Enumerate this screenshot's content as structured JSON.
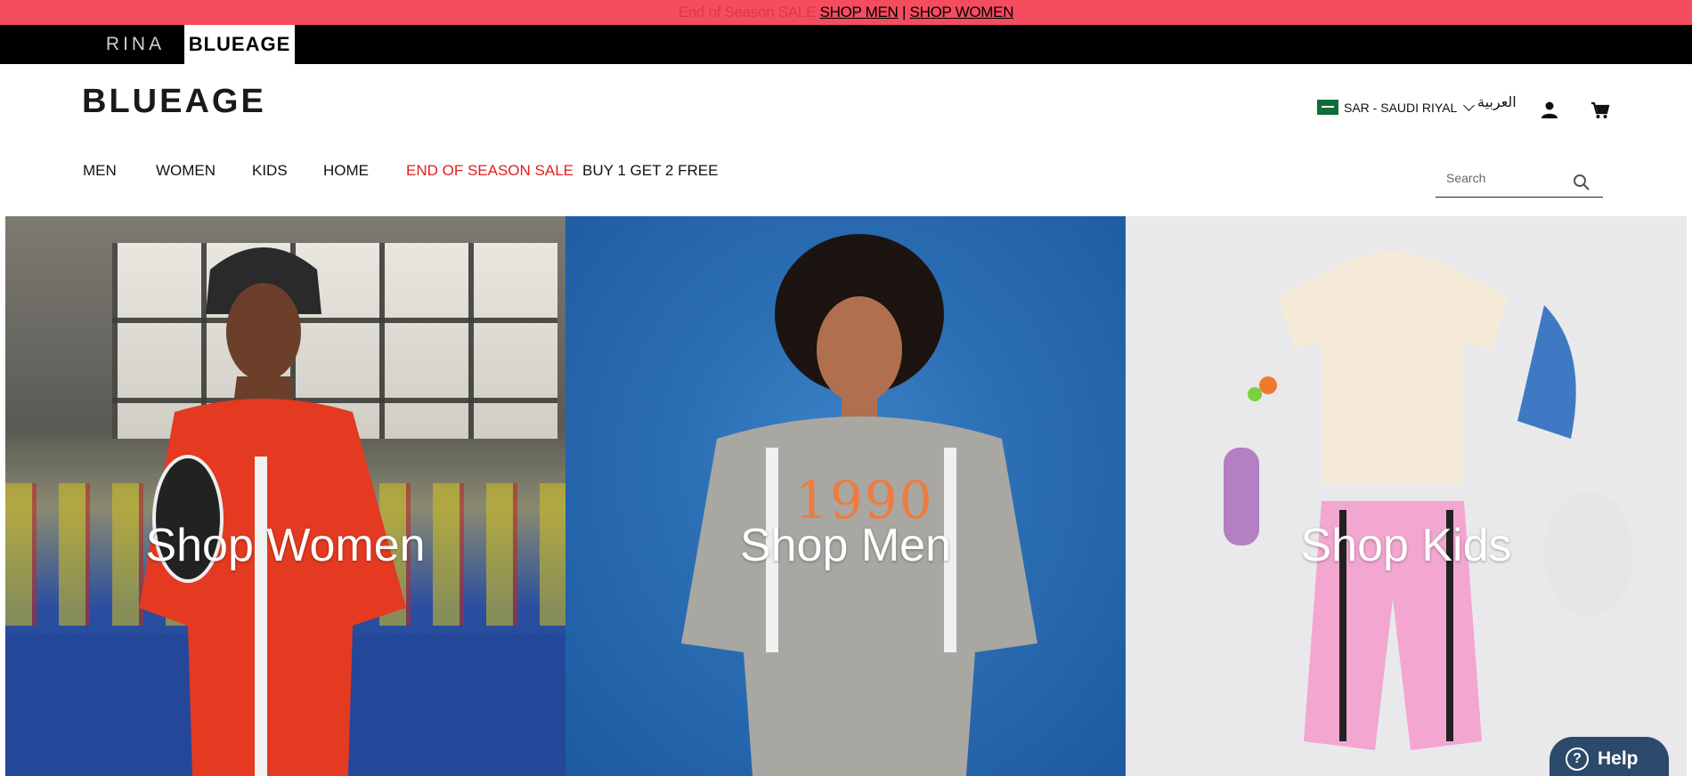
{
  "promo": {
    "faded_text": "End of Season SALE",
    "link_men": "SHOP MEN",
    "separator": "|",
    "link_women": "SHOP WOMEN",
    "bg_color": "#f64c5f"
  },
  "brands": {
    "rina": "RINA",
    "blueage": "BLUEAGE"
  },
  "header": {
    "logo": "BLUEAGE",
    "currency": "SAR - SAUDI RIYAL",
    "language": "العربية",
    "user_icon": "user-icon",
    "cart_icon": "cart-icon"
  },
  "nav": {
    "items": [
      "MEN",
      "WOMEN",
      "KIDS",
      "HOME",
      "END OF SEASON SALE",
      "BUY 1 GET 2 FREE"
    ],
    "sale_color": "#e0201e"
  },
  "search": {
    "placeholder": "Search"
  },
  "hero": {
    "panels": [
      {
        "title": "Shop Women"
      },
      {
        "title": "Shop Men",
        "shirt_text": "1990"
      },
      {
        "title": "Shop Kids"
      }
    ]
  },
  "help": {
    "label": "Help",
    "bg_color": "#2c4a6b"
  }
}
